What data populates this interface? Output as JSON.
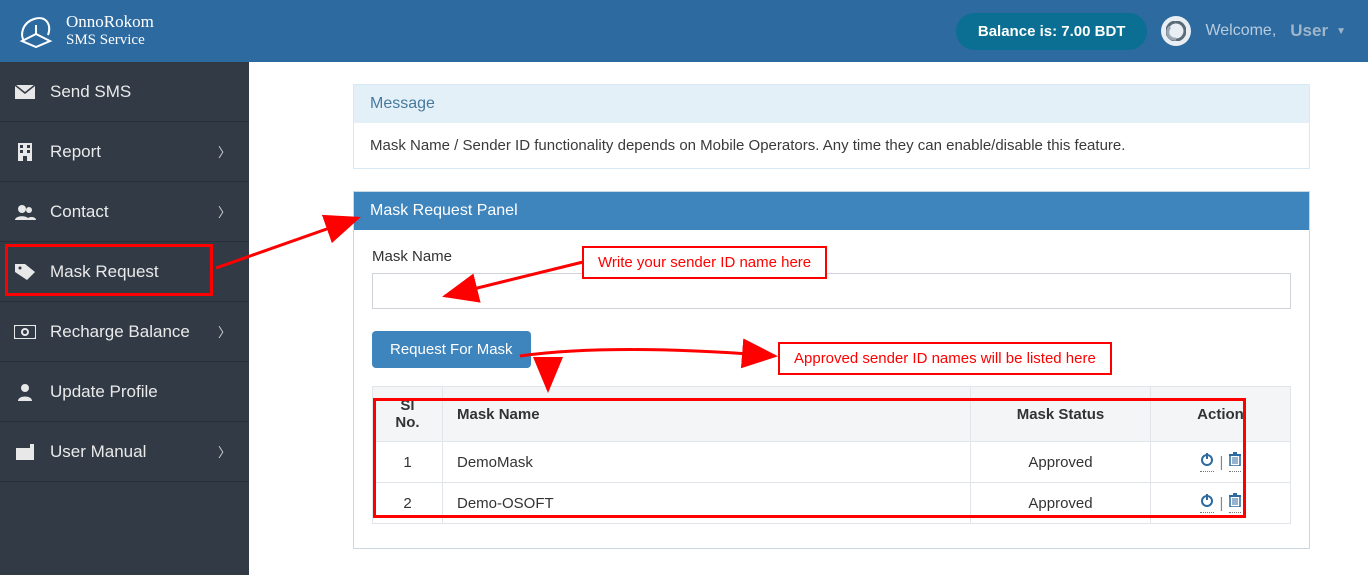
{
  "brand": {
    "line1": "OnnoRokom",
    "line2": "SMS Service"
  },
  "header": {
    "balance": "Balance is: 7.00 BDT",
    "welcome": "Welcome,",
    "user": "User"
  },
  "sidebar": {
    "items": [
      {
        "label": "Send SMS",
        "icon": "envelope",
        "has_sub": false
      },
      {
        "label": "Report",
        "icon": "building",
        "has_sub": true
      },
      {
        "label": "Contact",
        "icon": "users",
        "has_sub": true
      },
      {
        "label": "Mask Request",
        "icon": "tags",
        "has_sub": false,
        "active": true
      },
      {
        "label": "Recharge Balance",
        "icon": "cash",
        "has_sub": true
      },
      {
        "label": "Update Profile",
        "icon": "user",
        "has_sub": false
      },
      {
        "label": "User Manual",
        "icon": "manual",
        "has_sub": true
      }
    ]
  },
  "info": {
    "title": "Message",
    "body": "Mask Name / Sender ID functionality depends on Mobile Operators. Any time they can enable/disable this feature."
  },
  "panel": {
    "title": "Mask Request Panel",
    "mask_label": "Mask Name",
    "mask_value": "",
    "request_btn": "Request For Mask",
    "columns": {
      "slno": "Sl No.",
      "name": "Mask Name",
      "status": "Mask Status",
      "action": "Action"
    },
    "rows": [
      {
        "sl": "1",
        "name": "DemoMask",
        "status": "Approved"
      },
      {
        "sl": "2",
        "name": "Demo-OSOFT",
        "status": "Approved"
      }
    ]
  },
  "annotations": {
    "write_hint": "Write your sender ID name here",
    "approved_hint": "Approved sender ID names will be listed here"
  }
}
